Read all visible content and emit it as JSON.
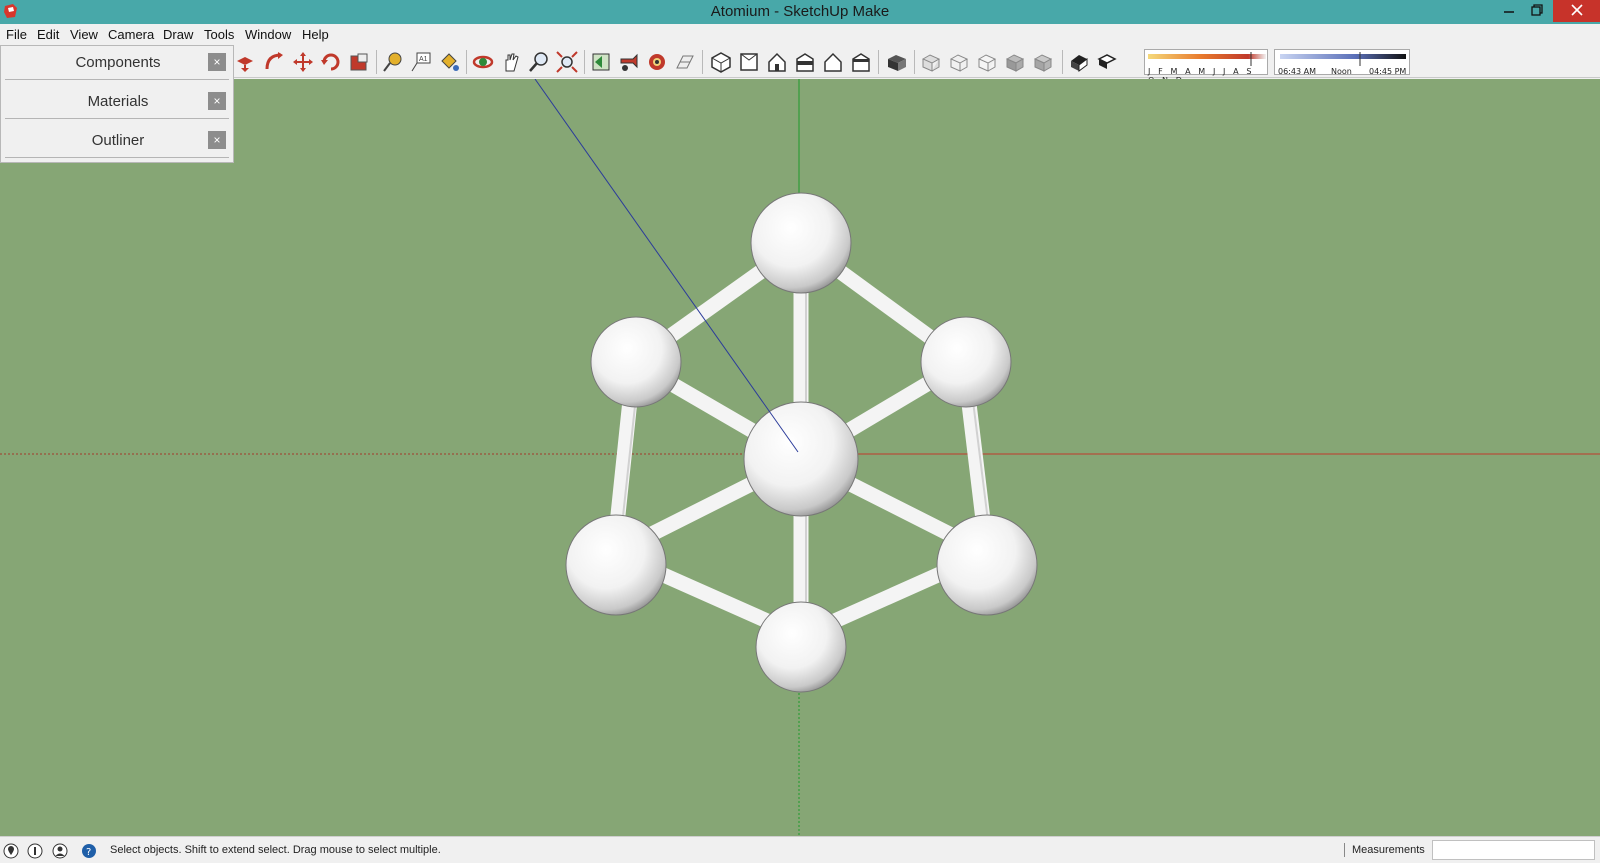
{
  "window": {
    "title": "Atomium - SketchUp Make"
  },
  "menu": {
    "items": [
      "File",
      "Edit",
      "View",
      "Camera",
      "Draw",
      "Tools",
      "Window",
      "Help"
    ]
  },
  "tray": {
    "panels": [
      {
        "label": "Components"
      },
      {
        "label": "Materials"
      },
      {
        "label": "Outliner"
      }
    ],
    "close_glyph": "×"
  },
  "toolbar": {
    "icons": [
      "push-pull",
      "follow-me",
      "move",
      "rotate",
      "scale",
      "tape-measure",
      "text",
      "paint-bucket",
      "orbit",
      "pan",
      "zoom",
      "zoom-extents",
      "previous-view",
      "position-camera",
      "walk",
      "look-around",
      "iso-view",
      "top-view",
      "front-view",
      "right-view",
      "back-view",
      "left-view",
      "component",
      "xray-style",
      "wireframe-style",
      "hidden-line-style",
      "shaded-style",
      "textured-style",
      "shadows-toggle",
      "fog-toggle"
    ],
    "shadow_months": "J F M A M J J A S O N D",
    "shadow_time_start": "06:43 AM",
    "shadow_time_mid": "Noon",
    "shadow_time_end": "04:45 PM"
  },
  "status": {
    "hint": "Select objects. Shift to extend select. Drag mouse to select multiple.",
    "measurements_label": "Measurements",
    "measurements_value": ""
  },
  "colors": {
    "titlebar": "#48a8a9",
    "viewport_bg": "#86a675",
    "axis_red": "#c0392b",
    "axis_green": "#1e9a2a",
    "axis_blue": "#2b3b9a"
  }
}
